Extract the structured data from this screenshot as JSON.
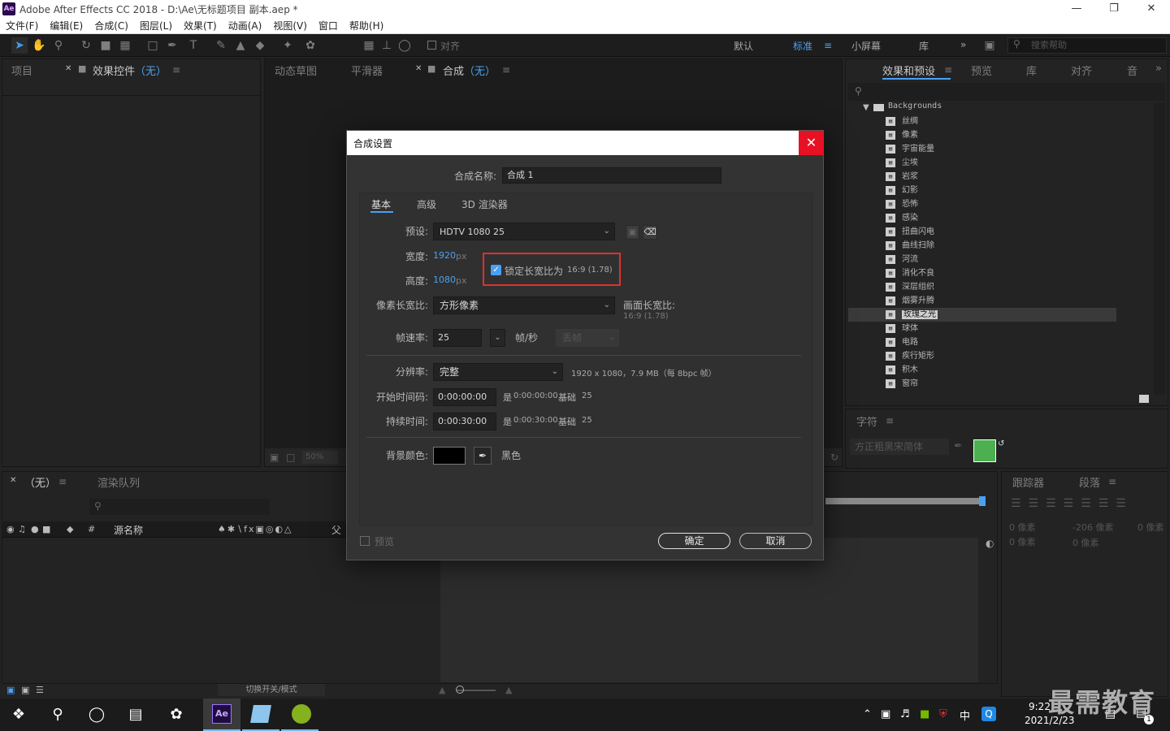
{
  "window": {
    "app_icon": "Ae",
    "title": "Adobe After Effects CC 2018 - D:\\Ae\\无标题项目 副本.aep *",
    "min_icon": "minimize-icon",
    "max_icon": "restore-icon",
    "close_icon": "close-icon"
  },
  "menu": [
    "文件(F)",
    "编辑(E)",
    "合成(C)",
    "图层(L)",
    "效果(T)",
    "动画(A)",
    "视图(V)",
    "窗口",
    "帮助(H)"
  ],
  "toolbar": {
    "snap_label": "对齐",
    "workspaces": [
      "默认",
      "标准",
      "小屏幕",
      "库"
    ],
    "active_workspace": "标准",
    "more": "»",
    "search_placeholder": "搜索帮助"
  },
  "panels": {
    "project_tab": "项目",
    "effect_controls_tab": "效果控件",
    "effect_controls_target": "（无）",
    "flowchart_tab": "动态草图",
    "smoother_tab": "平滑器",
    "comp_tab": "合成",
    "comp_target": "（无）",
    "viewer_zoom": "50%",
    "effects_tab": "效果和预设",
    "preview_tab": "预览",
    "library_tab": "库",
    "align_tab": "对齐",
    "audio_tab": "音",
    "character_tab": "字符",
    "font_name": "方正粗黑宋简体",
    "timeline_tab": "（无）",
    "render_queue_tab": "渲染队列",
    "layer_name_col": "源名称",
    "parent_col": "父",
    "hash_col": "#",
    "toggle_label": "切换开关/模式",
    "tracker_tab": "跟踪器",
    "paragraph_tab": "段落",
    "para_values": [
      "0 像素",
      "-206 像素",
      "0 像素",
      "0 像素",
      "0 像素"
    ]
  },
  "effects_tree": {
    "folder": "Backgrounds",
    "items": [
      "丝绸",
      "像素",
      "宇宙能量",
      "尘埃",
      "岩浆",
      "幻影",
      "恐怖",
      "感染",
      "扭曲闪电",
      "曲线扫除",
      "河流",
      "消化不良",
      "深层组织",
      "烟雾升腾",
      "玫瑰之光",
      "球体",
      "电路",
      "疾行矩形",
      "积木",
      "窗帘"
    ],
    "selected": "玫瑰之光"
  },
  "dialog": {
    "title": "合成设置",
    "name_label": "合成名称:",
    "name_value": "合成 1",
    "tabs": [
      "基本",
      "高级",
      "3D 渲染器"
    ],
    "preset_label": "预设:",
    "preset_value": "HDTV 1080 25",
    "width_label": "宽度:",
    "width_value": "1920",
    "height_label": "高度:",
    "height_value": "1080",
    "px": "px",
    "lock_label": "锁定长宽比为",
    "lock_ratio": "16:9 (1.78)",
    "lock_checked": true,
    "par_label": "像素长宽比:",
    "par_value": "方形像素",
    "frame_aspect_label": "画面长宽比:",
    "frame_aspect_value": "16:9 (1.78)",
    "fps_label": "帧速率:",
    "fps_value": "25",
    "fps_unit": "帧/秒",
    "drop_frame": "丢帧",
    "res_label": "分辨率:",
    "res_value": "完整",
    "res_info": "1920 x 1080，7.9 MB（每 8bpc 帧）",
    "start_label": "开始时间码:",
    "start_value": "0:00:00:00",
    "start_is": "是",
    "start_tc": "0:00:00:00",
    "base_label": "基础",
    "base_value": "25",
    "dur_label": "持续时间:",
    "dur_value": "0:00:30:00",
    "dur_is": "是",
    "dur_tc": "0:00:30:00",
    "bg_label": "背景颜色:",
    "bg_color": "#000000",
    "bg_name": "黑色",
    "preview_label": "预览",
    "ok": "确定",
    "cancel": "取消"
  },
  "taskbar": {
    "time": "9:22",
    "date": "2021/2/23",
    "ime": "中",
    "notif_count": "1",
    "watermark": "最需教育"
  },
  "colors": {
    "accent": "#4aa1f2",
    "highlight_box": "#e0312c",
    "fill_swatch": "#4caf50"
  }
}
